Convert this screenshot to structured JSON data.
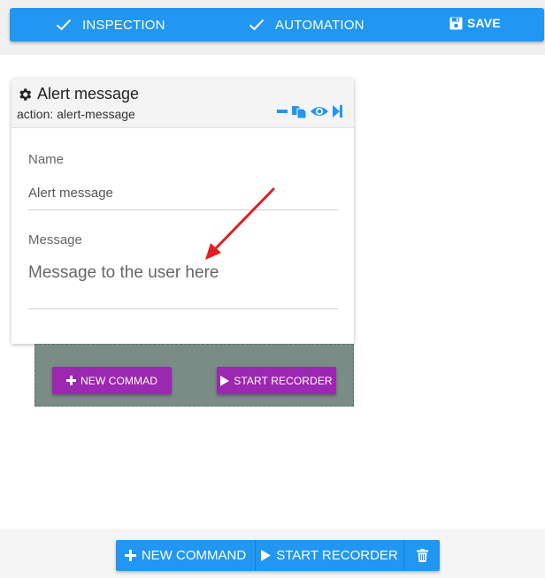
{
  "toolbar": {
    "inspection_label": "INSPECTION",
    "automation_label": "AUTOMATION",
    "save_label": "SAVE",
    "inspection_icon": "check-icon",
    "automation_icon": "check-icon",
    "save_icon": "floppy-disk-icon"
  },
  "command_card": {
    "title": "Alert message",
    "title_icon": "gear-icon",
    "action_text": "action: alert-message",
    "tools": [
      "minus-icon",
      "copy-icon",
      "eye-icon",
      "step-forward-icon"
    ],
    "fields": {
      "name_label": "Name",
      "name_value": "Alert message",
      "message_label": "Message",
      "message_value": "Message to the user here"
    }
  },
  "drop_area": {
    "new_command_label": "NEW COMMAD",
    "start_recorder_label": "START RECORDER"
  },
  "bottom_bar": {
    "new_command_label": "NEW COMMAND",
    "start_recorder_label": "START RECORDER",
    "delete_icon": "trash-icon"
  },
  "colors": {
    "primary": "#2196f3",
    "accent_purple": "#9c27b0",
    "drop_area": "#7a8c86",
    "annotation_arrow": "#e41e1e"
  }
}
